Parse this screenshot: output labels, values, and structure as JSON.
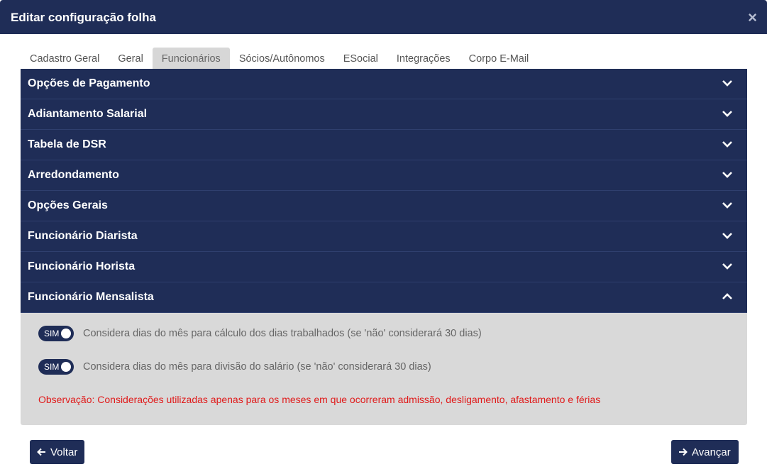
{
  "modal": {
    "title": "Editar configuração folha",
    "close_icon": "×"
  },
  "tabs": [
    {
      "label": "Cadastro Geral",
      "active": false
    },
    {
      "label": "Geral",
      "active": false
    },
    {
      "label": "Funcionários",
      "active": true
    },
    {
      "label": "Sócios/Autônomos",
      "active": false
    },
    {
      "label": "ESocial",
      "active": false
    },
    {
      "label": "Integrações",
      "active": false
    },
    {
      "label": "Corpo E-Mail",
      "active": false
    }
  ],
  "accordion": {
    "sections": [
      {
        "label": "Opções de Pagamento",
        "icon": "chevron-down-icon"
      },
      {
        "label": "Adiantamento Salarial",
        "icon": "chevron-down-icon"
      },
      {
        "label": "Tabela de DSR",
        "icon": "chevron-down-icon"
      },
      {
        "label": "Arredondamento",
        "icon": "chevron-down-icon"
      },
      {
        "label": "Opções Gerais",
        "icon": "chevron-down-icon"
      },
      {
        "label": "Funcionário Diarista",
        "icon": "chevron-down-icon"
      },
      {
        "label": "Funcionário Horista",
        "icon": "chevron-down-icon"
      },
      {
        "label": "Funcionário Mensalista",
        "icon": "chevron-up-icon"
      }
    ],
    "expanded_panel": {
      "toggles": [
        {
          "state_label": "SIM",
          "checked": true,
          "label": "Considera dias do mês para cálculo dos dias trabalhados (se 'não' considerará 30 dias)"
        },
        {
          "state_label": "SIM",
          "checked": true,
          "label": "Considera dias do mês para divisão do salário (se 'não' considerará 30 dias)"
        }
      ],
      "note": "Observação: Considerações utilizadas apenas para os meses em que ocorreram admissão, desligamento, afastamento e férias"
    }
  },
  "footer": {
    "back_label": "Voltar",
    "back_icon": "arrow-left-icon",
    "next_label": "Avançar",
    "next_icon": "arrow-right-icon"
  },
  "colors": {
    "primary": "#1f2d57",
    "panel_bg": "#d9d9d9",
    "note": "#e01b1b"
  }
}
